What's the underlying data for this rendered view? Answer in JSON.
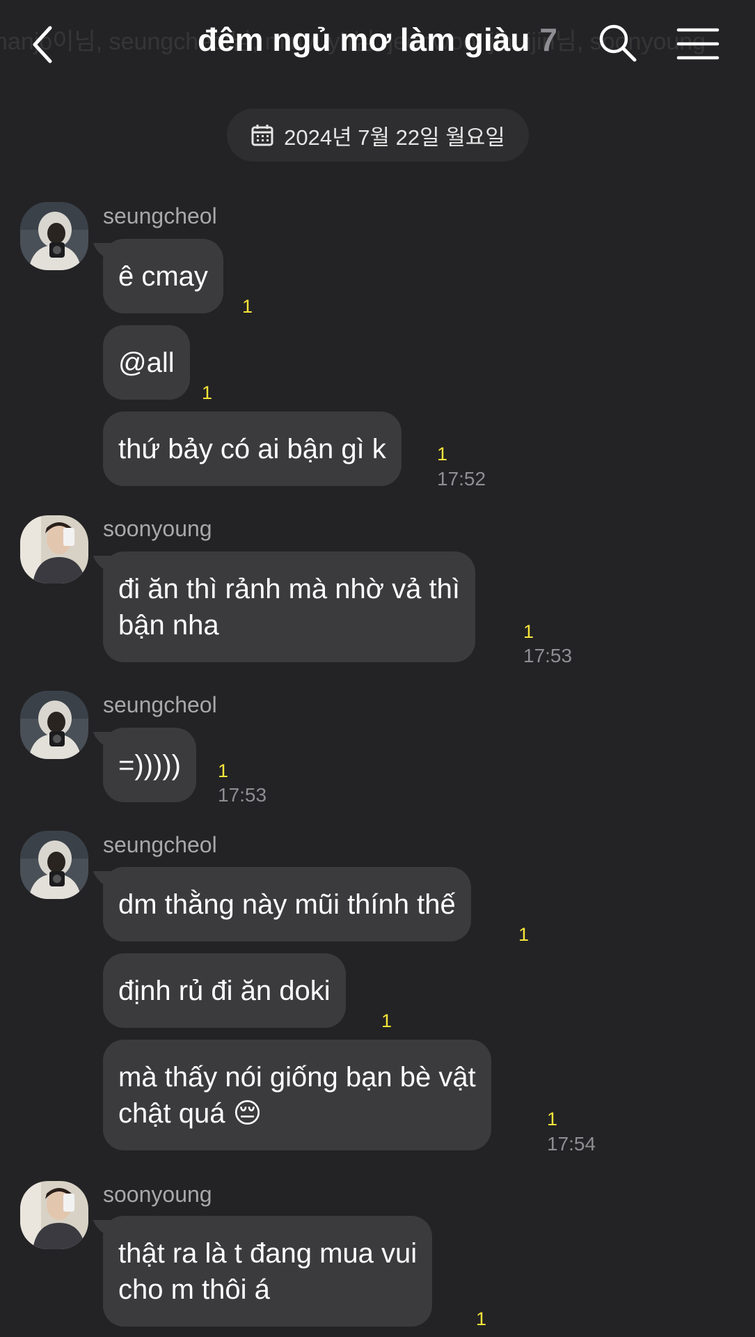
{
  "header": {
    "members_line": "hanjo이님, seungcheol님, minyuyh님, jeonwoo, jihuijin님, soonyoung",
    "title": "đêm ngủ mơ làm giàu",
    "member_count": "7",
    "icons": {
      "back": "chevron-left-icon",
      "search": "search-icon",
      "menu": "hamburger-menu-icon"
    }
  },
  "date_divider": {
    "text": "2024년 7월 22일 월요일",
    "icon": "calendar-icon"
  },
  "groups": [
    {
      "sender": "seungcheol",
      "messages": [
        {
          "text": "ê cmay",
          "unread": "1",
          "time": ""
        },
        {
          "text": "@all",
          "unread": "1",
          "time": ""
        },
        {
          "text": "thứ bảy có ai bận gì k",
          "unread": "1",
          "time": "17:52"
        }
      ]
    },
    {
      "sender": "soonyoung",
      "messages": [
        {
          "line1": "đi ăn thì rảnh mà nhờ vả thì",
          "line2": "bận nha",
          "unread": "1",
          "time": "17:53"
        }
      ]
    },
    {
      "sender": "seungcheol",
      "messages": [
        {
          "text": "=)))))",
          "unread": "1",
          "time": "17:53"
        }
      ]
    },
    {
      "sender": "seungcheol",
      "messages": [
        {
          "text": "dm thằng này mũi thính thế",
          "unread": "1",
          "time": ""
        },
        {
          "text": "định rủ đi ăn doki",
          "unread": "1",
          "time": ""
        },
        {
          "line1": "mà thấy nói giống bạn bè vật",
          "line2": "chật quá 😔",
          "unread": "1",
          "time": "17:54"
        }
      ]
    },
    {
      "sender": "soonyoung",
      "messages": [
        {
          "line1": "thật ra là t đang mua vui",
          "line2": "cho m thôi á",
          "unread": "1",
          "time": ""
        }
      ]
    }
  ],
  "colors": {
    "background": "#232325",
    "bubble": "#3b3b3e",
    "unread_count": "#f7e43a",
    "secondary_text": "#8e8e93"
  }
}
